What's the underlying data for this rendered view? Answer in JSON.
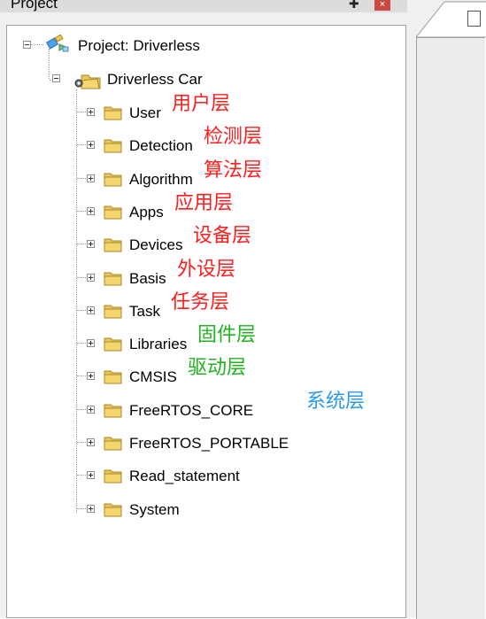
{
  "pane": {
    "title": "Project"
  },
  "tree": {
    "root": {
      "label": "Project: Driverless"
    },
    "target": {
      "label": "Driverless Car"
    },
    "groups": [
      {
        "label": "User",
        "annotation": "用户层",
        "annotation_color": "#ff1e1e"
      },
      {
        "label": "Detection",
        "annotation": "检测层",
        "annotation_color": "#ff1e1e"
      },
      {
        "label": "Algorithm",
        "annotation": "算法层",
        "annotation_color": "#ff1e1e"
      },
      {
        "label": "Apps",
        "annotation": "应用层",
        "annotation_color": "#ff1e1e"
      },
      {
        "label": "Devices",
        "annotation": "设备层",
        "annotation_color": "#ff1e1e"
      },
      {
        "label": "Basis",
        "annotation": "外设层",
        "annotation_color": "#ff1e1e"
      },
      {
        "label": "Task",
        "annotation": "任务层",
        "annotation_color": "#ff1e1e"
      },
      {
        "label": "Libraries",
        "annotation": "固件层",
        "annotation_color": "#1fb41f"
      },
      {
        "label": "CMSIS",
        "annotation": "驱动层",
        "annotation_color": "#1fb41f"
      },
      {
        "label": "FreeRTOS_CORE",
        "annotation": "系统层",
        "annotation_color": "#2c9be6"
      },
      {
        "label": "FreeRTOS_PORTABLE"
      },
      {
        "label": "Read_statement"
      },
      {
        "label": "System"
      }
    ]
  },
  "icons": {
    "pin": "pin-icon",
    "close": "close-icon",
    "folder": "folder-icon",
    "project": "project-icon",
    "target": "target-folder-icon"
  },
  "colors": {
    "annotation_red": "#ff1e1e",
    "annotation_green": "#1fb41f",
    "annotation_blue": "#2c9be6",
    "folder_yellow": "#f5d66e"
  }
}
